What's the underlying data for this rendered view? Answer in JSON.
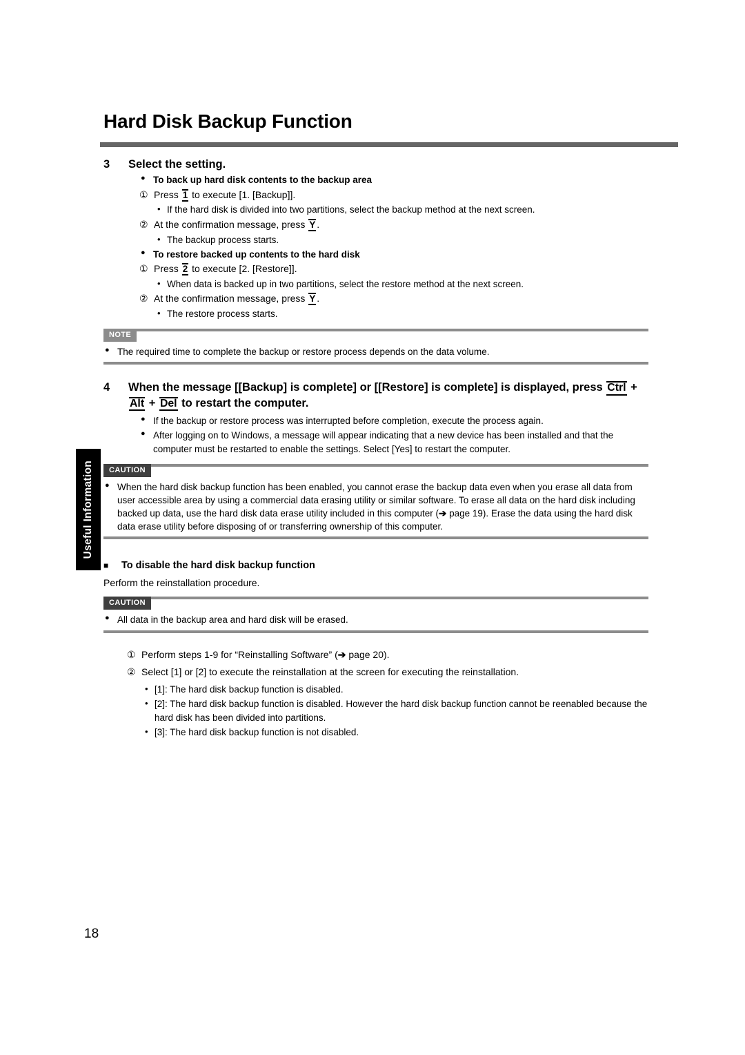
{
  "page": {
    "title": "Hard Disk Backup Function",
    "number": "18",
    "side_tab": "Useful Information"
  },
  "step3": {
    "number": "3",
    "heading": "Select the setting.",
    "backup_heading": "To back up hard disk contents to the backup area",
    "backup_1_pre": "Press",
    "backup_1_key": "1",
    "backup_1_post": "to execute [1. [Backup]].",
    "backup_1_sub": "If the hard disk is divided into two partitions, select the backup method at the next screen.",
    "backup_2_pre": "At the confirmation message, press",
    "backup_2_key": "Y",
    "backup_2_post": ".",
    "backup_2_sub": "The backup process starts.",
    "restore_heading": "To restore backed up contents to the hard disk",
    "restore_1_pre": "Press",
    "restore_1_key": "2",
    "restore_1_post": "to execute [2. [Restore]].",
    "restore_1_sub": "When data is backed up in two partitions, select the restore method at the next screen.",
    "restore_2_pre": "At the confirmation message, press",
    "restore_2_key": "Y",
    "restore_2_post": ".",
    "restore_2_sub": "The restore process starts.",
    "marker_disc": "●",
    "marker_circ_1": "①",
    "marker_circ_2": "②",
    "marker_dot": "•"
  },
  "note_box": {
    "badge": "NOTE",
    "bullet": "●",
    "text": "The required time to complete the backup or restore process depends on the data volume."
  },
  "step4": {
    "number": "4",
    "heading_part1": "When the message [[Backup] is complete] or [[Restore] is complete] is displayed, press",
    "key_ctrl": "Ctrl",
    "plus1": "+",
    "key_alt": "Alt",
    "plus2": "+",
    "key_del": "Del",
    "heading_part2": "to restart the computer.",
    "bullet1": "If the backup or restore process was interrupted before completion, execute the process again.",
    "bullet2": "After logging on to Windows, a message will appear indicating that a new device has been installed and that the computer must be restarted to enable the settings. Select [Yes] to restart the computer.",
    "marker_disc": "●"
  },
  "caution_box_1": {
    "badge": "CAUTION",
    "bullet": "●",
    "text_before_arrow": "When the hard disk backup function has been enabled, you cannot erase the backup data even when you erase all data from user accessible area by using a commercial data erasing utility or similar software. To erase all data on the hard disk including backed up data, use the hard disk data erase utility included in this computer (",
    "arrow": "➔",
    "page_ref": " page 19",
    "text_after_arrow": "). Erase the data using the hard disk data erase utility before disposing of or transferring ownership of this computer."
  },
  "disable_section": {
    "marker_square": "■",
    "heading": "To disable the hard disk backup function",
    "body": "Perform the reinstallation procedure."
  },
  "caution_box_2": {
    "badge": "CAUTION",
    "bullet": "●",
    "text": "All data in the backup area and hard disk will be erased."
  },
  "tail_list": {
    "marker_circ_1": "①",
    "marker_circ_2": "②",
    "marker_dot": "•",
    "item1_before_arrow": "Perform steps 1-9 for “Reinstalling Software” (",
    "item1_arrow": "➔",
    "item1_page_ref": " page 20",
    "item1_after_arrow": ").",
    "item2": "Select [1] or [2] to execute the reinstallation at the screen for executing the reinstallation.",
    "sub1": "[1]: The hard disk backup function is disabled.",
    "sub2": "[2]: The hard disk backup function is disabled. However the hard disk backup function cannot be reenabled because the hard disk has been divided into partitions.",
    "sub3": "[3]: The hard disk backup function is not disabled."
  }
}
